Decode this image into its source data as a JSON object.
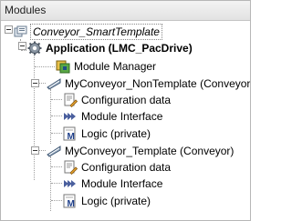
{
  "panel": {
    "title": "Modules"
  },
  "tree": {
    "root": {
      "label": "Conveyor_SmartTemplate",
      "icon": "project-icon"
    },
    "application": {
      "label": "Application (LMC_PacDrive)",
      "icon": "gear-icon"
    },
    "module_manager": {
      "label": "Module Manager",
      "icon": "module-manager-icon"
    },
    "non_template": {
      "label": "MyConveyor_NonTemplate (Conveyor)",
      "icon": "conveyor-icon",
      "children": [
        {
          "label": "Configuration data",
          "icon": "config-data-icon"
        },
        {
          "label": "Module Interface",
          "icon": "module-interface-icon"
        },
        {
          "label": "Logic (private)",
          "icon": "logic-icon"
        }
      ]
    },
    "template": {
      "label": "MyConveyor_Template (Conveyor)",
      "icon": "conveyor-icon",
      "children": [
        {
          "label": "Configuration data",
          "icon": "config-data-icon"
        },
        {
          "label": "Module Interface",
          "icon": "module-interface-icon"
        },
        {
          "label": "Logic (private)",
          "icon": "logic-icon"
        }
      ]
    }
  }
}
